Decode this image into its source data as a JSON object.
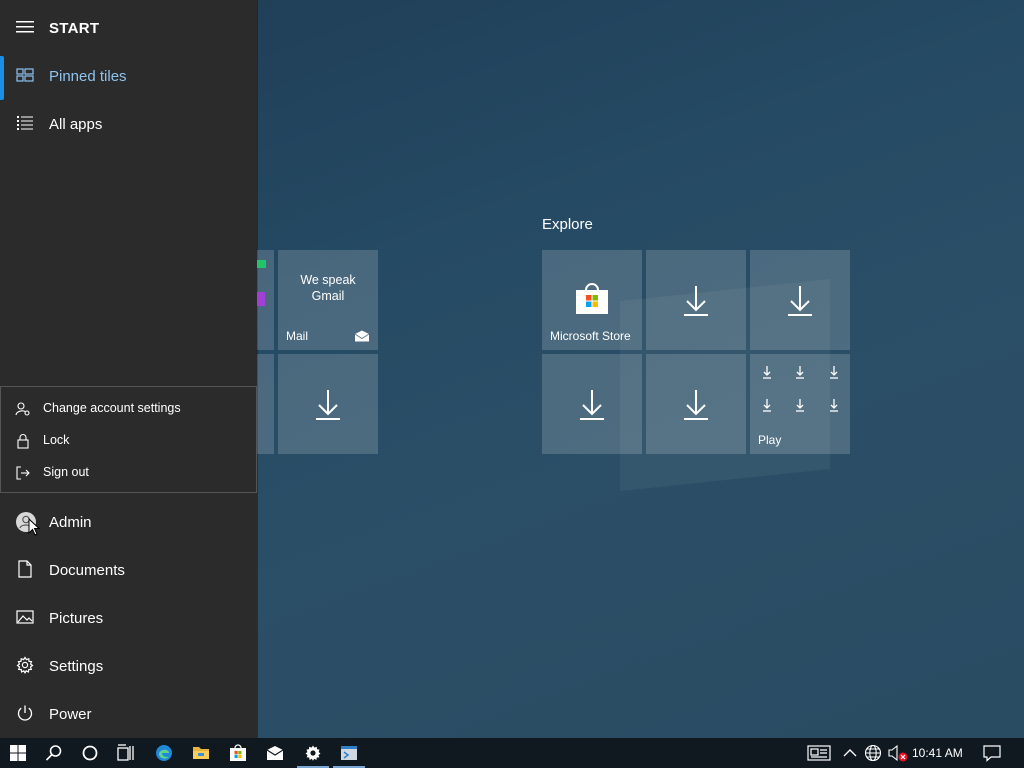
{
  "start": {
    "title": "START",
    "nav": [
      {
        "label": "Pinned tiles",
        "icon": "tiles-icon",
        "active": true
      },
      {
        "label": "All apps",
        "icon": "list-icon",
        "active": false
      }
    ],
    "account_menu": [
      {
        "label": "Change account settings",
        "icon": "account-settings-icon"
      },
      {
        "label": "Lock",
        "icon": "lock-icon"
      },
      {
        "label": "Sign out",
        "icon": "sign-out-icon"
      }
    ],
    "bottom": [
      {
        "label": "Admin",
        "icon": "user-avatar-icon"
      },
      {
        "label": "Documents",
        "icon": "document-icon"
      },
      {
        "label": "Pictures",
        "icon": "pictures-icon"
      },
      {
        "label": "Settings",
        "icon": "gear-icon"
      },
      {
        "label": "Power",
        "icon": "power-icon"
      }
    ]
  },
  "tiles": {
    "left_group": {
      "mail": {
        "headline": "We speak\nGmail",
        "label": "Mail"
      }
    },
    "explore": {
      "title": "Explore",
      "store_label": "Microsoft Store",
      "play_label": "Play"
    }
  },
  "taskbar": {
    "items": [
      "start-button",
      "search-icon",
      "cortana-icon",
      "task-view-icon",
      "edge-icon",
      "file-explorer-icon",
      "store-icon",
      "mail-icon",
      "settings-icon",
      "app-icon"
    ],
    "clock": "10:41 AM"
  },
  "colors": {
    "accent": "#1b8fe6",
    "nav_bg": "#2b2b2b",
    "taskbar_bg": "#101820",
    "tile_bg": "rgba(255,255,255,0.17)"
  }
}
